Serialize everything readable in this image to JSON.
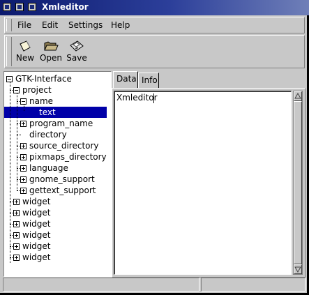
{
  "window": {
    "title": "Xmleditor"
  },
  "menu": {
    "items": [
      "File",
      "Edit",
      "Settings",
      "Help"
    ]
  },
  "toolbar": {
    "new_label": "New",
    "new_icon": "new-document-icon",
    "open_label": "Open",
    "open_icon": "folder-open-icon",
    "save_label": "Save",
    "save_icon": "floppy-disk-icon"
  },
  "tree": {
    "nodes": [
      {
        "label": "GTK-Interface",
        "expander": "minus",
        "selected": false
      },
      {
        "label": "project",
        "expander": "minus",
        "selected": false
      },
      {
        "label": "name",
        "expander": "minus",
        "selected": false
      },
      {
        "label": "text",
        "expander": "none",
        "selected": true
      },
      {
        "label": "program_name",
        "expander": "plus",
        "selected": false
      },
      {
        "label": "directory",
        "expander": "none",
        "selected": false
      },
      {
        "label": "source_directory",
        "expander": "plus",
        "selected": false
      },
      {
        "label": "pixmaps_directory",
        "expander": "plus",
        "selected": false
      },
      {
        "label": "language",
        "expander": "plus",
        "selected": false
      },
      {
        "label": "gnome_support",
        "expander": "plus",
        "selected": false
      },
      {
        "label": "gettext_support",
        "expander": "plus",
        "selected": false
      },
      {
        "label": "widget",
        "expander": "plus",
        "selected": false
      },
      {
        "label": "widget",
        "expander": "plus",
        "selected": false
      },
      {
        "label": "widget",
        "expander": "plus",
        "selected": false
      },
      {
        "label": "widget",
        "expander": "plus",
        "selected": false
      },
      {
        "label": "widget",
        "expander": "plus",
        "selected": false
      },
      {
        "label": "widget",
        "expander": "plus",
        "selected": false
      }
    ]
  },
  "notebook": {
    "tabs": [
      "Data",
      "Info"
    ],
    "active_tab": "Data",
    "text_value": "Xmleditor"
  },
  "status": {
    "left": "",
    "right": ""
  },
  "colors": {
    "selection": "#0000a8",
    "titlebar": "#1a2a7a",
    "background": "#c8c8c8"
  }
}
